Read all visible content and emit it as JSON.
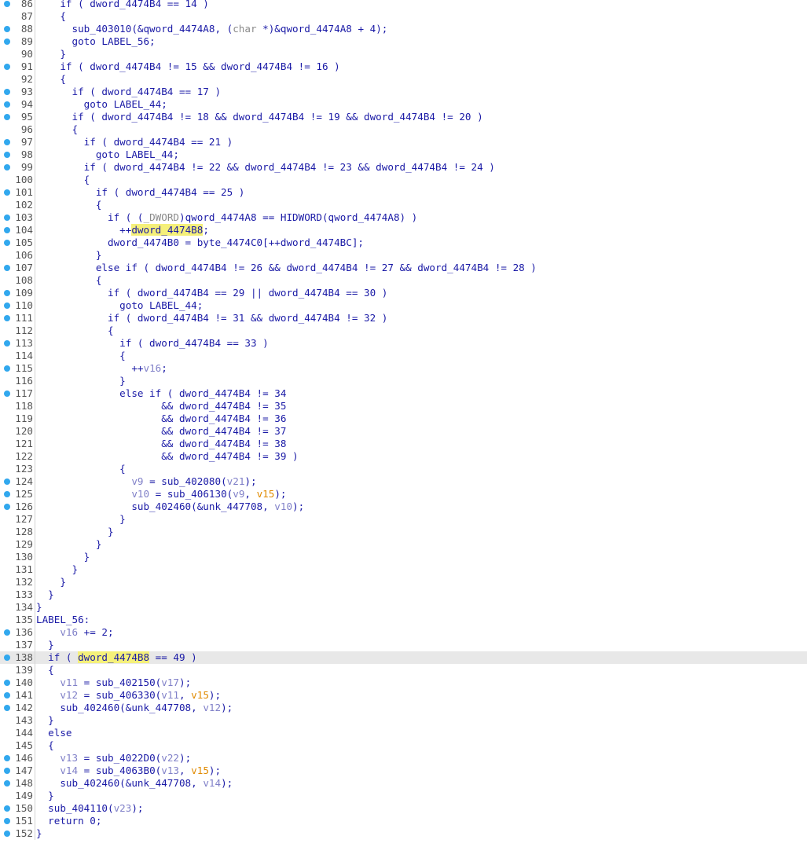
{
  "editor": {
    "lines": [
      {
        "n": "86",
        "bp": true,
        "cur": false,
        "tokens": [
          {
            "t": "    if ( dword_4474B4 == 14 )"
          }
        ]
      },
      {
        "n": "87",
        "bp": false,
        "cur": false,
        "tokens": [
          {
            "t": "    {"
          }
        ]
      },
      {
        "n": "88",
        "bp": true,
        "cur": false,
        "tokens": [
          {
            "t": "      sub_403010(&qword_4474A8, ("
          },
          {
            "t": "char",
            "c": "type"
          },
          {
            "t": " *)&qword_4474A8 + 4);"
          }
        ]
      },
      {
        "n": "89",
        "bp": true,
        "cur": false,
        "tokens": [
          {
            "t": "      goto LABEL_56;"
          }
        ]
      },
      {
        "n": "90",
        "bp": false,
        "cur": false,
        "tokens": [
          {
            "t": "    }"
          }
        ]
      },
      {
        "n": "91",
        "bp": true,
        "cur": false,
        "tokens": [
          {
            "t": "    if ( dword_4474B4 != 15 && dword_4474B4 != 16 )"
          }
        ]
      },
      {
        "n": "92",
        "bp": false,
        "cur": false,
        "tokens": [
          {
            "t": "    {"
          }
        ]
      },
      {
        "n": "93",
        "bp": true,
        "cur": false,
        "tokens": [
          {
            "t": "      if ( dword_4474B4 == 17 )"
          }
        ]
      },
      {
        "n": "94",
        "bp": true,
        "cur": false,
        "tokens": [
          {
            "t": "        goto LABEL_44;"
          }
        ]
      },
      {
        "n": "95",
        "bp": true,
        "cur": false,
        "tokens": [
          {
            "t": "      if ( dword_4474B4 != 18 && dword_4474B4 != 19 && dword_4474B4 != 20 )"
          }
        ]
      },
      {
        "n": "96",
        "bp": false,
        "cur": false,
        "tokens": [
          {
            "t": "      {"
          }
        ]
      },
      {
        "n": "97",
        "bp": true,
        "cur": false,
        "tokens": [
          {
            "t": "        if ( dword_4474B4 == 21 )"
          }
        ]
      },
      {
        "n": "98",
        "bp": true,
        "cur": false,
        "tokens": [
          {
            "t": "          goto LABEL_44;"
          }
        ]
      },
      {
        "n": "99",
        "bp": true,
        "cur": false,
        "tokens": [
          {
            "t": "        if ( dword_4474B4 != 22 && dword_4474B4 != 23 && dword_4474B4 != 24 )"
          }
        ]
      },
      {
        "n": "100",
        "bp": false,
        "cur": false,
        "tokens": [
          {
            "t": "        {"
          }
        ]
      },
      {
        "n": "101",
        "bp": true,
        "cur": false,
        "tokens": [
          {
            "t": "          if ( dword_4474B4 == 25 )"
          }
        ]
      },
      {
        "n": "102",
        "bp": false,
        "cur": false,
        "tokens": [
          {
            "t": "          {"
          }
        ]
      },
      {
        "n": "103",
        "bp": true,
        "cur": false,
        "tokens": [
          {
            "t": "            if ( ("
          },
          {
            "t": "_DWORD",
            "c": "type"
          },
          {
            "t": ")qword_4474A8 == HIDWORD(qword_4474A8) )"
          }
        ]
      },
      {
        "n": "104",
        "bp": true,
        "cur": false,
        "tokens": [
          {
            "t": "              ++"
          },
          {
            "t": "dword_4474B8",
            "c": "hl"
          },
          {
            "t": ";"
          }
        ]
      },
      {
        "n": "105",
        "bp": true,
        "cur": false,
        "tokens": [
          {
            "t": "            dword_4474B0 = byte_4474C0[++dword_4474BC];"
          }
        ]
      },
      {
        "n": "106",
        "bp": false,
        "cur": false,
        "tokens": [
          {
            "t": "          }"
          }
        ]
      },
      {
        "n": "107",
        "bp": true,
        "cur": false,
        "tokens": [
          {
            "t": "          else if ( dword_4474B4 != 26 && dword_4474B4 != 27 && dword_4474B4 != 28 )"
          }
        ]
      },
      {
        "n": "108",
        "bp": false,
        "cur": false,
        "tokens": [
          {
            "t": "          {"
          }
        ]
      },
      {
        "n": "109",
        "bp": true,
        "cur": false,
        "tokens": [
          {
            "t": "            if ( dword_4474B4 == 29 || dword_4474B4 == 30 )"
          }
        ]
      },
      {
        "n": "110",
        "bp": true,
        "cur": false,
        "tokens": [
          {
            "t": "              goto LABEL_44;"
          }
        ]
      },
      {
        "n": "111",
        "bp": true,
        "cur": false,
        "tokens": [
          {
            "t": "            if ( dword_4474B4 != 31 && dword_4474B4 != 32 )"
          }
        ]
      },
      {
        "n": "112",
        "bp": false,
        "cur": false,
        "tokens": [
          {
            "t": "            {"
          }
        ]
      },
      {
        "n": "113",
        "bp": true,
        "cur": false,
        "tokens": [
          {
            "t": "              if ( dword_4474B4 == 33 )"
          }
        ]
      },
      {
        "n": "114",
        "bp": false,
        "cur": false,
        "tokens": [
          {
            "t": "              {"
          }
        ]
      },
      {
        "n": "115",
        "bp": true,
        "cur": false,
        "tokens": [
          {
            "t": "                ++"
          },
          {
            "t": "v16",
            "c": "var"
          },
          {
            "t": ";"
          }
        ]
      },
      {
        "n": "116",
        "bp": false,
        "cur": false,
        "tokens": [
          {
            "t": "              }"
          }
        ]
      },
      {
        "n": "117",
        "bp": true,
        "cur": false,
        "tokens": [
          {
            "t": "              else if ( dword_4474B4 != 34"
          }
        ]
      },
      {
        "n": "118",
        "bp": false,
        "cur": false,
        "tokens": [
          {
            "t": "                     && dword_4474B4 != 35"
          }
        ]
      },
      {
        "n": "119",
        "bp": false,
        "cur": false,
        "tokens": [
          {
            "t": "                     && dword_4474B4 != 36"
          }
        ]
      },
      {
        "n": "120",
        "bp": false,
        "cur": false,
        "tokens": [
          {
            "t": "                     && dword_4474B4 != 37"
          }
        ]
      },
      {
        "n": "121",
        "bp": false,
        "cur": false,
        "tokens": [
          {
            "t": "                     && dword_4474B4 != 38"
          }
        ]
      },
      {
        "n": "122",
        "bp": false,
        "cur": false,
        "tokens": [
          {
            "t": "                     && dword_4474B4 != 39 )"
          }
        ]
      },
      {
        "n": "123",
        "bp": false,
        "cur": false,
        "tokens": [
          {
            "t": "              {"
          }
        ]
      },
      {
        "n": "124",
        "bp": true,
        "cur": false,
        "tokens": [
          {
            "t": "                "
          },
          {
            "t": "v9",
            "c": "var"
          },
          {
            "t": " = sub_402080("
          },
          {
            "t": "v21",
            "c": "var"
          },
          {
            "t": ");"
          }
        ]
      },
      {
        "n": "125",
        "bp": true,
        "cur": false,
        "tokens": [
          {
            "t": "                "
          },
          {
            "t": "v10",
            "c": "var"
          },
          {
            "t": " = sub_406130("
          },
          {
            "t": "v9",
            "c": "var"
          },
          {
            "t": ", "
          },
          {
            "t": "v15",
            "c": "arg"
          },
          {
            "t": ");"
          }
        ]
      },
      {
        "n": "126",
        "bp": true,
        "cur": false,
        "tokens": [
          {
            "t": "                sub_402460(&unk_447708, "
          },
          {
            "t": "v10",
            "c": "var"
          },
          {
            "t": ");"
          }
        ]
      },
      {
        "n": "127",
        "bp": false,
        "cur": false,
        "tokens": [
          {
            "t": "              }"
          }
        ]
      },
      {
        "n": "128",
        "bp": false,
        "cur": false,
        "tokens": [
          {
            "t": "            }"
          }
        ]
      },
      {
        "n": "129",
        "bp": false,
        "cur": false,
        "tokens": [
          {
            "t": "          }"
          }
        ]
      },
      {
        "n": "130",
        "bp": false,
        "cur": false,
        "tokens": [
          {
            "t": "        }"
          }
        ]
      },
      {
        "n": "131",
        "bp": false,
        "cur": false,
        "tokens": [
          {
            "t": "      }"
          }
        ]
      },
      {
        "n": "132",
        "bp": false,
        "cur": false,
        "tokens": [
          {
            "t": "    }"
          }
        ]
      },
      {
        "n": "133",
        "bp": false,
        "cur": false,
        "tokens": [
          {
            "t": "  }"
          }
        ]
      },
      {
        "n": "134",
        "bp": false,
        "cur": false,
        "tokens": [
          {
            "t": "}"
          }
        ]
      },
      {
        "n": "135",
        "bp": false,
        "cur": false,
        "tokens": [
          {
            "t": "LABEL_56:"
          }
        ]
      },
      {
        "n": "136",
        "bp": true,
        "cur": false,
        "tokens": [
          {
            "t": "    "
          },
          {
            "t": "v16",
            "c": "var"
          },
          {
            "t": " += 2;"
          }
        ]
      },
      {
        "n": "137",
        "bp": false,
        "cur": false,
        "tokens": [
          {
            "t": "  }"
          }
        ]
      },
      {
        "n": "138",
        "bp": true,
        "cur": true,
        "tokens": [
          {
            "t": "  if ( "
          },
          {
            "t": "dword_4474B8",
            "c": "hl"
          },
          {
            "t": " == 49 )"
          }
        ]
      },
      {
        "n": "139",
        "bp": false,
        "cur": false,
        "tokens": [
          {
            "t": "  {"
          }
        ]
      },
      {
        "n": "140",
        "bp": true,
        "cur": false,
        "tokens": [
          {
            "t": "    "
          },
          {
            "t": "v11",
            "c": "var"
          },
          {
            "t": " = sub_402150("
          },
          {
            "t": "v17",
            "c": "var"
          },
          {
            "t": ");"
          }
        ]
      },
      {
        "n": "141",
        "bp": true,
        "cur": false,
        "tokens": [
          {
            "t": "    "
          },
          {
            "t": "v12",
            "c": "var"
          },
          {
            "t": " = sub_406330("
          },
          {
            "t": "v11",
            "c": "var"
          },
          {
            "t": ", "
          },
          {
            "t": "v15",
            "c": "arg"
          },
          {
            "t": ");"
          }
        ]
      },
      {
        "n": "142",
        "bp": true,
        "cur": false,
        "tokens": [
          {
            "t": "    sub_402460(&unk_447708, "
          },
          {
            "t": "v12",
            "c": "var"
          },
          {
            "t": ");"
          }
        ]
      },
      {
        "n": "143",
        "bp": false,
        "cur": false,
        "tokens": [
          {
            "t": "  }"
          }
        ]
      },
      {
        "n": "144",
        "bp": false,
        "cur": false,
        "tokens": [
          {
            "t": "  else"
          }
        ]
      },
      {
        "n": "145",
        "bp": false,
        "cur": false,
        "tokens": [
          {
            "t": "  {"
          }
        ]
      },
      {
        "n": "146",
        "bp": true,
        "cur": false,
        "tokens": [
          {
            "t": "    "
          },
          {
            "t": "v13",
            "c": "var"
          },
          {
            "t": " = sub_4022D0("
          },
          {
            "t": "v22",
            "c": "var"
          },
          {
            "t": ");"
          }
        ]
      },
      {
        "n": "147",
        "bp": true,
        "cur": false,
        "tokens": [
          {
            "t": "    "
          },
          {
            "t": "v14",
            "c": "var"
          },
          {
            "t": " = sub_4063B0("
          },
          {
            "t": "v13",
            "c": "var"
          },
          {
            "t": ", "
          },
          {
            "t": "v15",
            "c": "arg"
          },
          {
            "t": ");"
          }
        ]
      },
      {
        "n": "148",
        "bp": true,
        "cur": false,
        "tokens": [
          {
            "t": "    sub_402460(&unk_447708, "
          },
          {
            "t": "v14",
            "c": "var"
          },
          {
            "t": ");"
          }
        ]
      },
      {
        "n": "149",
        "bp": false,
        "cur": false,
        "tokens": [
          {
            "t": "  }"
          }
        ]
      },
      {
        "n": "150",
        "bp": true,
        "cur": false,
        "tokens": [
          {
            "t": "  sub_404110("
          },
          {
            "t": "v23",
            "c": "var"
          },
          {
            "t": ");"
          }
        ]
      },
      {
        "n": "151",
        "bp": true,
        "cur": false,
        "tokens": [
          {
            "t": "  return 0;"
          }
        ]
      },
      {
        "n": "152",
        "bp": true,
        "cur": false,
        "tokens": [
          {
            "t": "}"
          }
        ]
      }
    ]
  },
  "colors": {
    "code_text": "#1a1aa6",
    "local_var": "#8080c8",
    "argument": "#e08a00",
    "type_cast": "#8a8a8a",
    "highlight": "#f5f07a",
    "breakpoint_dot": "#31a8ee",
    "cursor_line": "#e8e8e8"
  }
}
